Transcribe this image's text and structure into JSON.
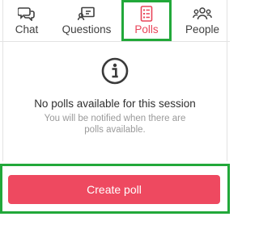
{
  "tabs": {
    "chat": {
      "label": "Chat",
      "icon": "chat-bubbles-icon"
    },
    "questions": {
      "label": "Questions",
      "icon": "question-board-icon"
    },
    "polls": {
      "label": "Polls",
      "icon": "poll-list-icon",
      "active": true
    },
    "people": {
      "label": "People",
      "icon": "people-group-icon"
    }
  },
  "empty_state": {
    "icon": "info-icon",
    "title": "No polls available for this session",
    "subtitle": "You will be notified when there are polls available."
  },
  "actions": {
    "create_poll_label": "Create poll"
  },
  "colors": {
    "accent": "#ee4960",
    "active_tab": "#e9455a",
    "highlight_border": "#22a83a",
    "text": "#3f3f3f",
    "muted": "#9a9a9a"
  }
}
